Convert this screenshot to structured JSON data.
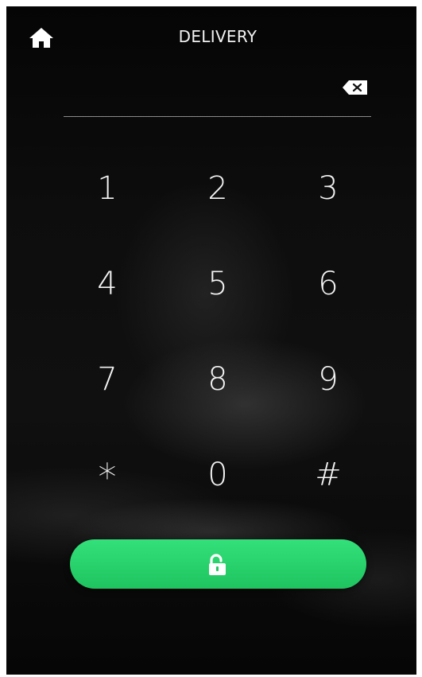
{
  "header": {
    "title": "DELIVERY",
    "home_icon": "home-icon"
  },
  "input": {
    "code": "",
    "backspace_icon": "backspace-icon"
  },
  "keypad": {
    "keys": [
      "1",
      "2",
      "3",
      "4",
      "5",
      "6",
      "7",
      "8",
      "9",
      "*",
      "0",
      "#"
    ]
  },
  "unlock_button": {
    "icon": "unlocked-padlock-icon",
    "color": "#2bd86c"
  },
  "colors": {
    "background": "#0b0b0b",
    "text": "#f4f4f4",
    "accent": "#2bd86c"
  }
}
